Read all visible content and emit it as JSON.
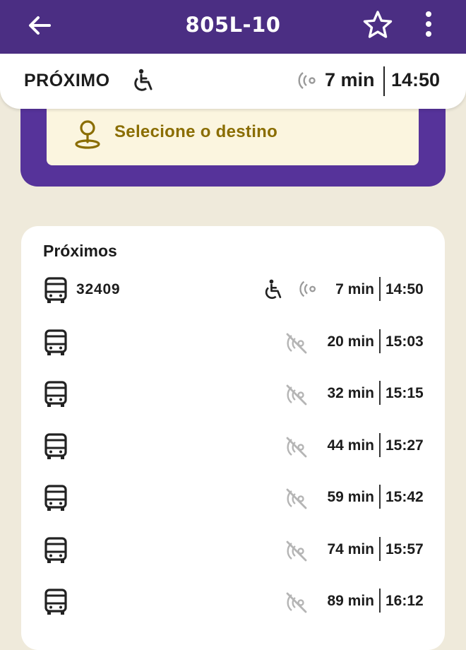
{
  "header": {
    "title": "805L-10",
    "back_icon": "back-arrow-icon",
    "favorite_icon": "star-outline-icon",
    "menu_icon": "more-vertical-icon"
  },
  "next_bar": {
    "label": "PRÓXIMO",
    "accessible_icon": "wheelchair-icon",
    "realtime_icon": "realtime-signal-icon",
    "minutes": "7 min",
    "time": "14:50"
  },
  "destination": {
    "text": "Selecione o destino",
    "icon": "map-pin-icon"
  },
  "upcoming": {
    "heading": "Próximos",
    "rows": [
      {
        "vehicle": "32409",
        "accessible": true,
        "realtime": true,
        "minutes": "7 min",
        "time": "14:50"
      },
      {
        "vehicle": "",
        "accessible": false,
        "realtime": false,
        "minutes": "20 min",
        "time": "15:03"
      },
      {
        "vehicle": "",
        "accessible": false,
        "realtime": false,
        "minutes": "32 min",
        "time": "15:15"
      },
      {
        "vehicle": "",
        "accessible": false,
        "realtime": false,
        "minutes": "44 min",
        "time": "15:27"
      },
      {
        "vehicle": "",
        "accessible": false,
        "realtime": false,
        "minutes": "59 min",
        "time": "15:42"
      },
      {
        "vehicle": "",
        "accessible": false,
        "realtime": false,
        "minutes": "74 min",
        "time": "15:57"
      },
      {
        "vehicle": "",
        "accessible": false,
        "realtime": false,
        "minutes": "89 min",
        "time": "16:12"
      }
    ]
  },
  "colors": {
    "header": "#4b2e83",
    "panel": "#56339a",
    "destination_text": "#8a6d00",
    "background": "#efeadb"
  }
}
